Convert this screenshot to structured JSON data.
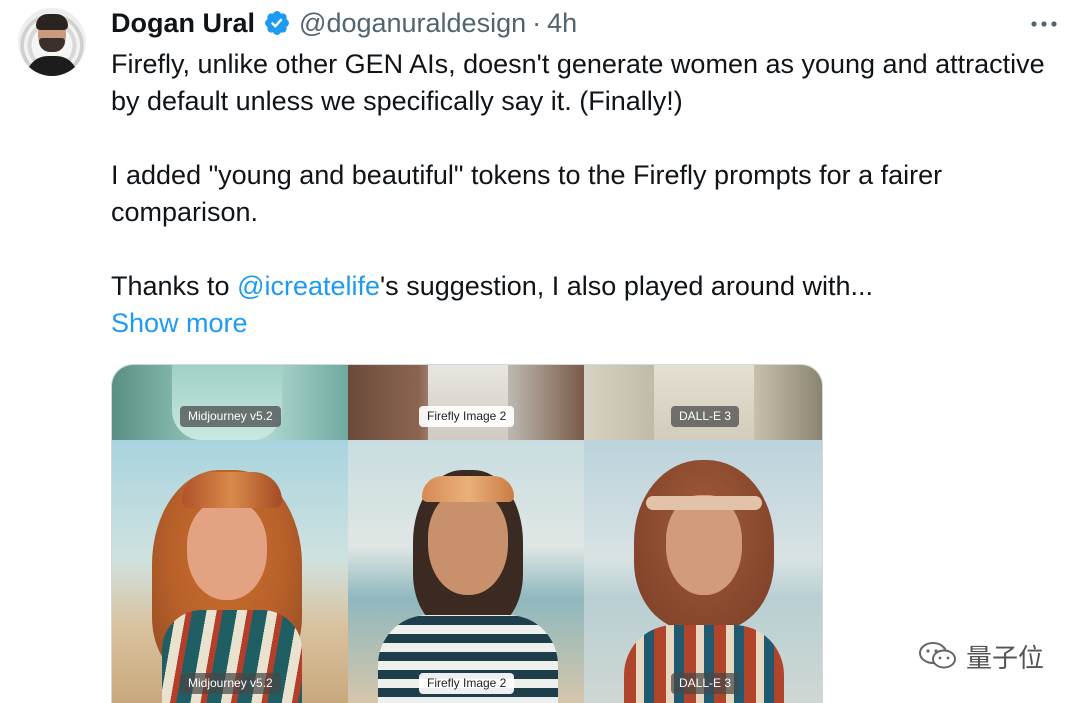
{
  "tweet": {
    "author_name": "Dogan Ural",
    "handle": "@doganuraldesign",
    "separator": "·",
    "time": "4h",
    "line1": "Firefly, unlike other GEN AIs, doesn't generate women as young and attractive by default unless we specifically say it. (Finally!)",
    "line2": "I added \"young and beautiful\" tokens to the Firefly prompts for a fairer comparison.",
    "line3_prefix": "Thanks to ",
    "mention": "@icreatelife",
    "line3_suffix": "'s suggestion, I also played around with...",
    "show_more": "Show more"
  },
  "media": {
    "top_labels": [
      "Midjourney v5.2",
      "Firefly Image 2",
      "DALL-E 3"
    ],
    "bottom_labels": [
      "Midjourney v5.2",
      "Firefly Image 2",
      "DALL-E 3"
    ]
  },
  "watermark": {
    "text": "量子位"
  },
  "colors": {
    "accent": "#1d9bf0",
    "secondary_text": "#536471",
    "primary_text": "#0f1419"
  },
  "icons": {
    "verified": "verified-badge-icon",
    "more": "more-options-icon",
    "watermark": "wechat-icon"
  }
}
